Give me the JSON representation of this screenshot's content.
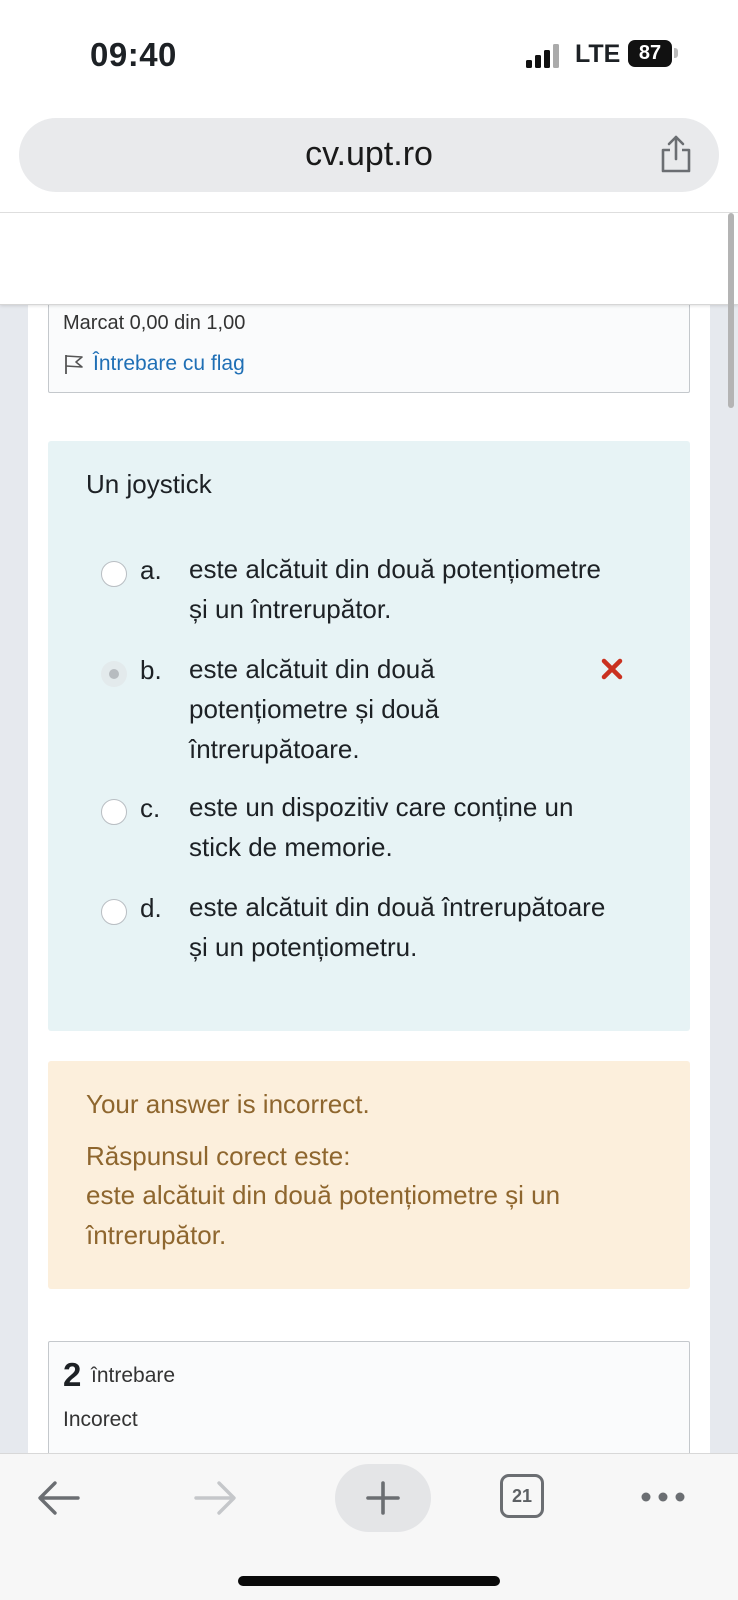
{
  "status_bar": {
    "time": "09:40",
    "network": "LTE",
    "battery": "87"
  },
  "browser": {
    "url": "cv.upt.ro",
    "open_tabs": "21"
  },
  "previous_question": {
    "marked": "Marcat 0,00 din 1,00",
    "flag_label": "Întrebare cu flag"
  },
  "question": {
    "text": "Un joystick",
    "answers": [
      {
        "letter": "a.",
        "line1": "este alcătuit din două potențiometre",
        "line2": "și un întrerupător.",
        "line3": "",
        "selected": false
      },
      {
        "letter": "b.",
        "line1": "este alcătuit din două",
        "line2": "potențiometre și două",
        "line3": "întrerupătoare.",
        "selected": true,
        "mark": "incorrect"
      },
      {
        "letter": "c.",
        "line1": "este un dispozitiv care conține un",
        "line2": "stick de memorie.",
        "line3": "",
        "selected": false
      },
      {
        "letter": "d.",
        "line1": "este alcătuit din două întrerupătoare",
        "line2": "și un potențiometru.",
        "line3": "",
        "selected": false
      }
    ]
  },
  "feedback": {
    "result": "Your answer is incorrect.",
    "correct_label": "Răspunsul corect este:",
    "correct_answer": "este alcătuit din două potențiometre și un întrerupător."
  },
  "next_question": {
    "number": "2",
    "label": "întrebare",
    "status": "Incorect"
  },
  "colors": {
    "question_bg": "#e7f3f5",
    "feedback_bg": "#fcefdc",
    "feedback_text": "#8e662e",
    "link": "#1f6fb5",
    "incorrect_mark": "#ca3120"
  }
}
